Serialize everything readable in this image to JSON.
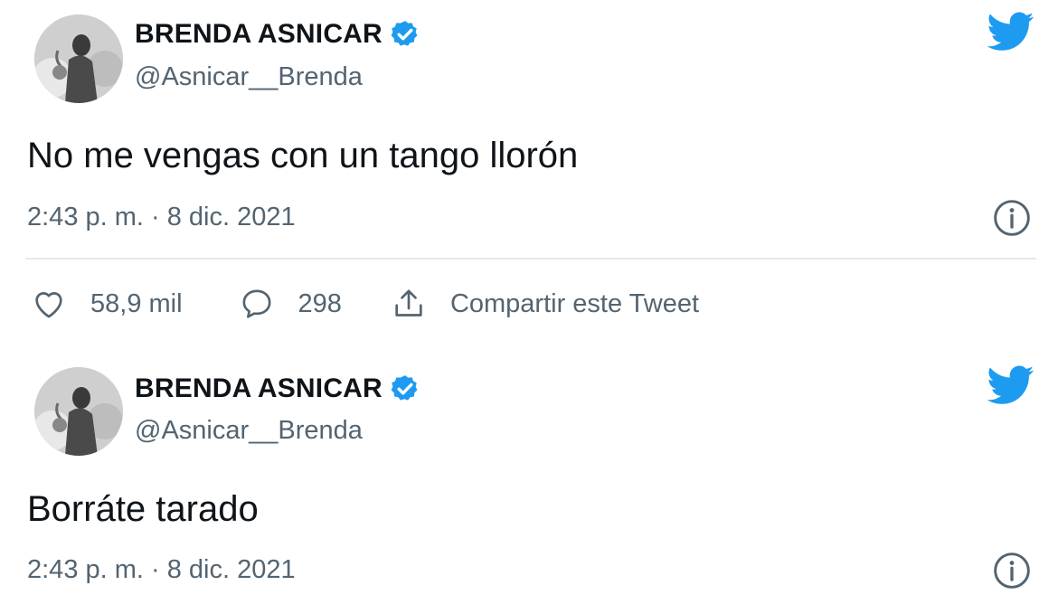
{
  "tweets": [
    {
      "author_name": "BRENDA ASNICAR",
      "handle": "@Asnicar__Brenda",
      "text": "No me vengas con un tango llorón",
      "timestamp": "2:43 p. m. · 8 dic. 2021",
      "likes": "58,9 mil",
      "replies": "298",
      "share_label": "Compartir este Tweet"
    },
    {
      "author_name": "BRENDA ASNICAR",
      "handle": "@Asnicar__Brenda",
      "text": "Borráte tarado",
      "timestamp": "2:43 p. m. · 8 dic. 2021"
    }
  ],
  "icons": {
    "verified": "verified-badge-icon",
    "logo": "twitter-bird-icon",
    "info": "info-icon",
    "like": "heart-icon",
    "reply": "reply-bubble-icon",
    "share": "share-icon"
  },
  "colors": {
    "brand_blue": "#1d9bf0",
    "text_primary": "#0f1419",
    "text_secondary": "#536471",
    "divider": "#e6e9ec"
  }
}
